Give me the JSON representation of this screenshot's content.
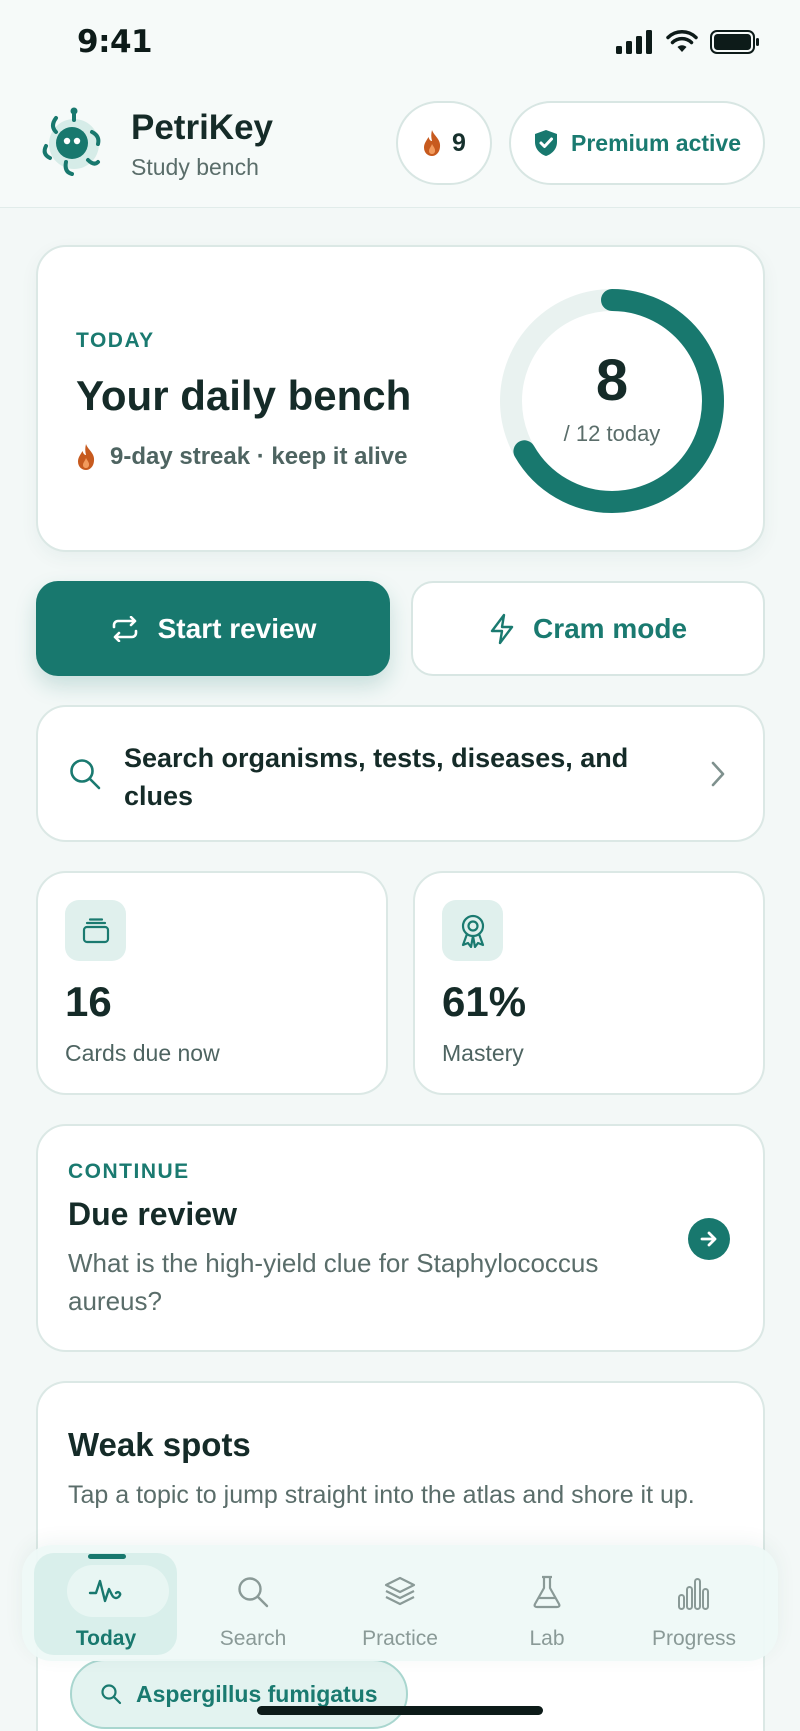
{
  "status_bar": {
    "time": "9:41"
  },
  "header": {
    "brand_name": "PetriKey",
    "brand_subtitle": "Study bench",
    "streak_count": "9",
    "premium_label": "Premium active"
  },
  "today_card": {
    "eyebrow": "TODAY",
    "title": "Your daily bench",
    "streak_text": "9-day streak · keep it alive",
    "progress_value": "8",
    "progress_label": "/ 12 today",
    "progress_done": 8,
    "progress_goal": 12
  },
  "actions": {
    "start_review": "Start review",
    "cram_mode": "Cram mode"
  },
  "search": {
    "placeholder": "Search organisms, tests, diseases, and clues"
  },
  "stats": [
    {
      "value": "16",
      "label": "Cards due now",
      "icon": "cards-icon"
    },
    {
      "value": "61%",
      "label": "Mastery",
      "icon": "award-icon"
    }
  ],
  "continue": {
    "eyebrow": "CONTINUE",
    "title": "Due review",
    "description": "What is the high-yield clue for Staphylococcus aureus?"
  },
  "weak_spots": {
    "title": "Weak spots",
    "description": "Tap a topic to jump straight into the atlas and shore it up.",
    "topics": [
      "Aspergillus fumigatus"
    ]
  },
  "tab_bar": {
    "tabs": [
      {
        "label": "Today",
        "icon": "activity-icon",
        "active": true
      },
      {
        "label": "Search",
        "icon": "search-icon",
        "active": false
      },
      {
        "label": "Practice",
        "icon": "layers-icon",
        "active": false
      },
      {
        "label": "Lab",
        "icon": "flask-icon",
        "active": false
      },
      {
        "label": "Progress",
        "icon": "bar-chart-icon",
        "active": false
      }
    ]
  },
  "colors": {
    "accent": "#18786e",
    "background": "#f3f8f7",
    "streak_flame": "#c75a1e"
  }
}
